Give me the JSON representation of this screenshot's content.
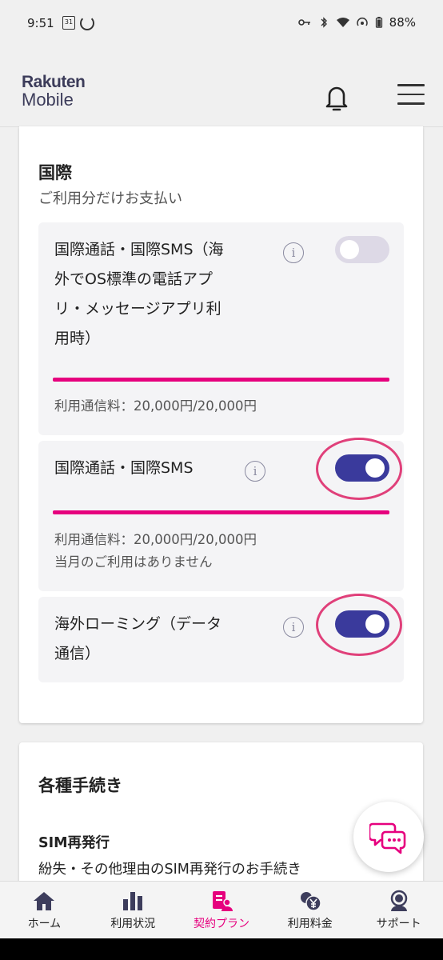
{
  "status_bar": {
    "time": "9:51",
    "calendar_day": "31",
    "battery": "88%"
  },
  "header": {
    "logo_line1": "Rakuten",
    "logo_line2": "Mobile"
  },
  "international": {
    "title": "国際",
    "subtitle": "ご利用分だけお支払い",
    "items": [
      {
        "label_lines": [
          "国際通話・国際SMS（海",
          "外でOS標準の電話アプ",
          "リ・メッセージアプリ利",
          "用時）"
        ],
        "toggle": "off",
        "usage_lines": [
          "利用通信料：20,000円/20,000円"
        ],
        "progress": 1.0
      },
      {
        "label_lines": [
          "国際通話・国際SMS"
        ],
        "toggle": "on",
        "usage_lines": [
          "利用通信料：20,000円/20,000円",
          "当月のご利用はありません"
        ],
        "progress": 1.0
      },
      {
        "label_lines": [
          "海外ローミング（データ",
          "通信）"
        ],
        "toggle": "on"
      }
    ]
  },
  "procedures": {
    "title": "各種手続き",
    "item_title": "SIM再発行",
    "item_desc": "紛失・その他理由のSIM再発行のお手続き"
  },
  "bottom_nav": {
    "items": [
      {
        "label": "ホーム",
        "icon": "home-icon"
      },
      {
        "label": "利用状況",
        "icon": "bar-chart-icon"
      },
      {
        "label": "契約プラン",
        "icon": "contract-plan-icon",
        "active": true
      },
      {
        "label": "利用料金",
        "icon": "yen-fee-icon"
      },
      {
        "label": "サポート",
        "icon": "support-icon"
      }
    ]
  },
  "colors": {
    "accent": "#e6007e",
    "toggle_on": "#3a3a9c",
    "toggle_off": "#ddd9e6",
    "ring": "#e0407a"
  }
}
